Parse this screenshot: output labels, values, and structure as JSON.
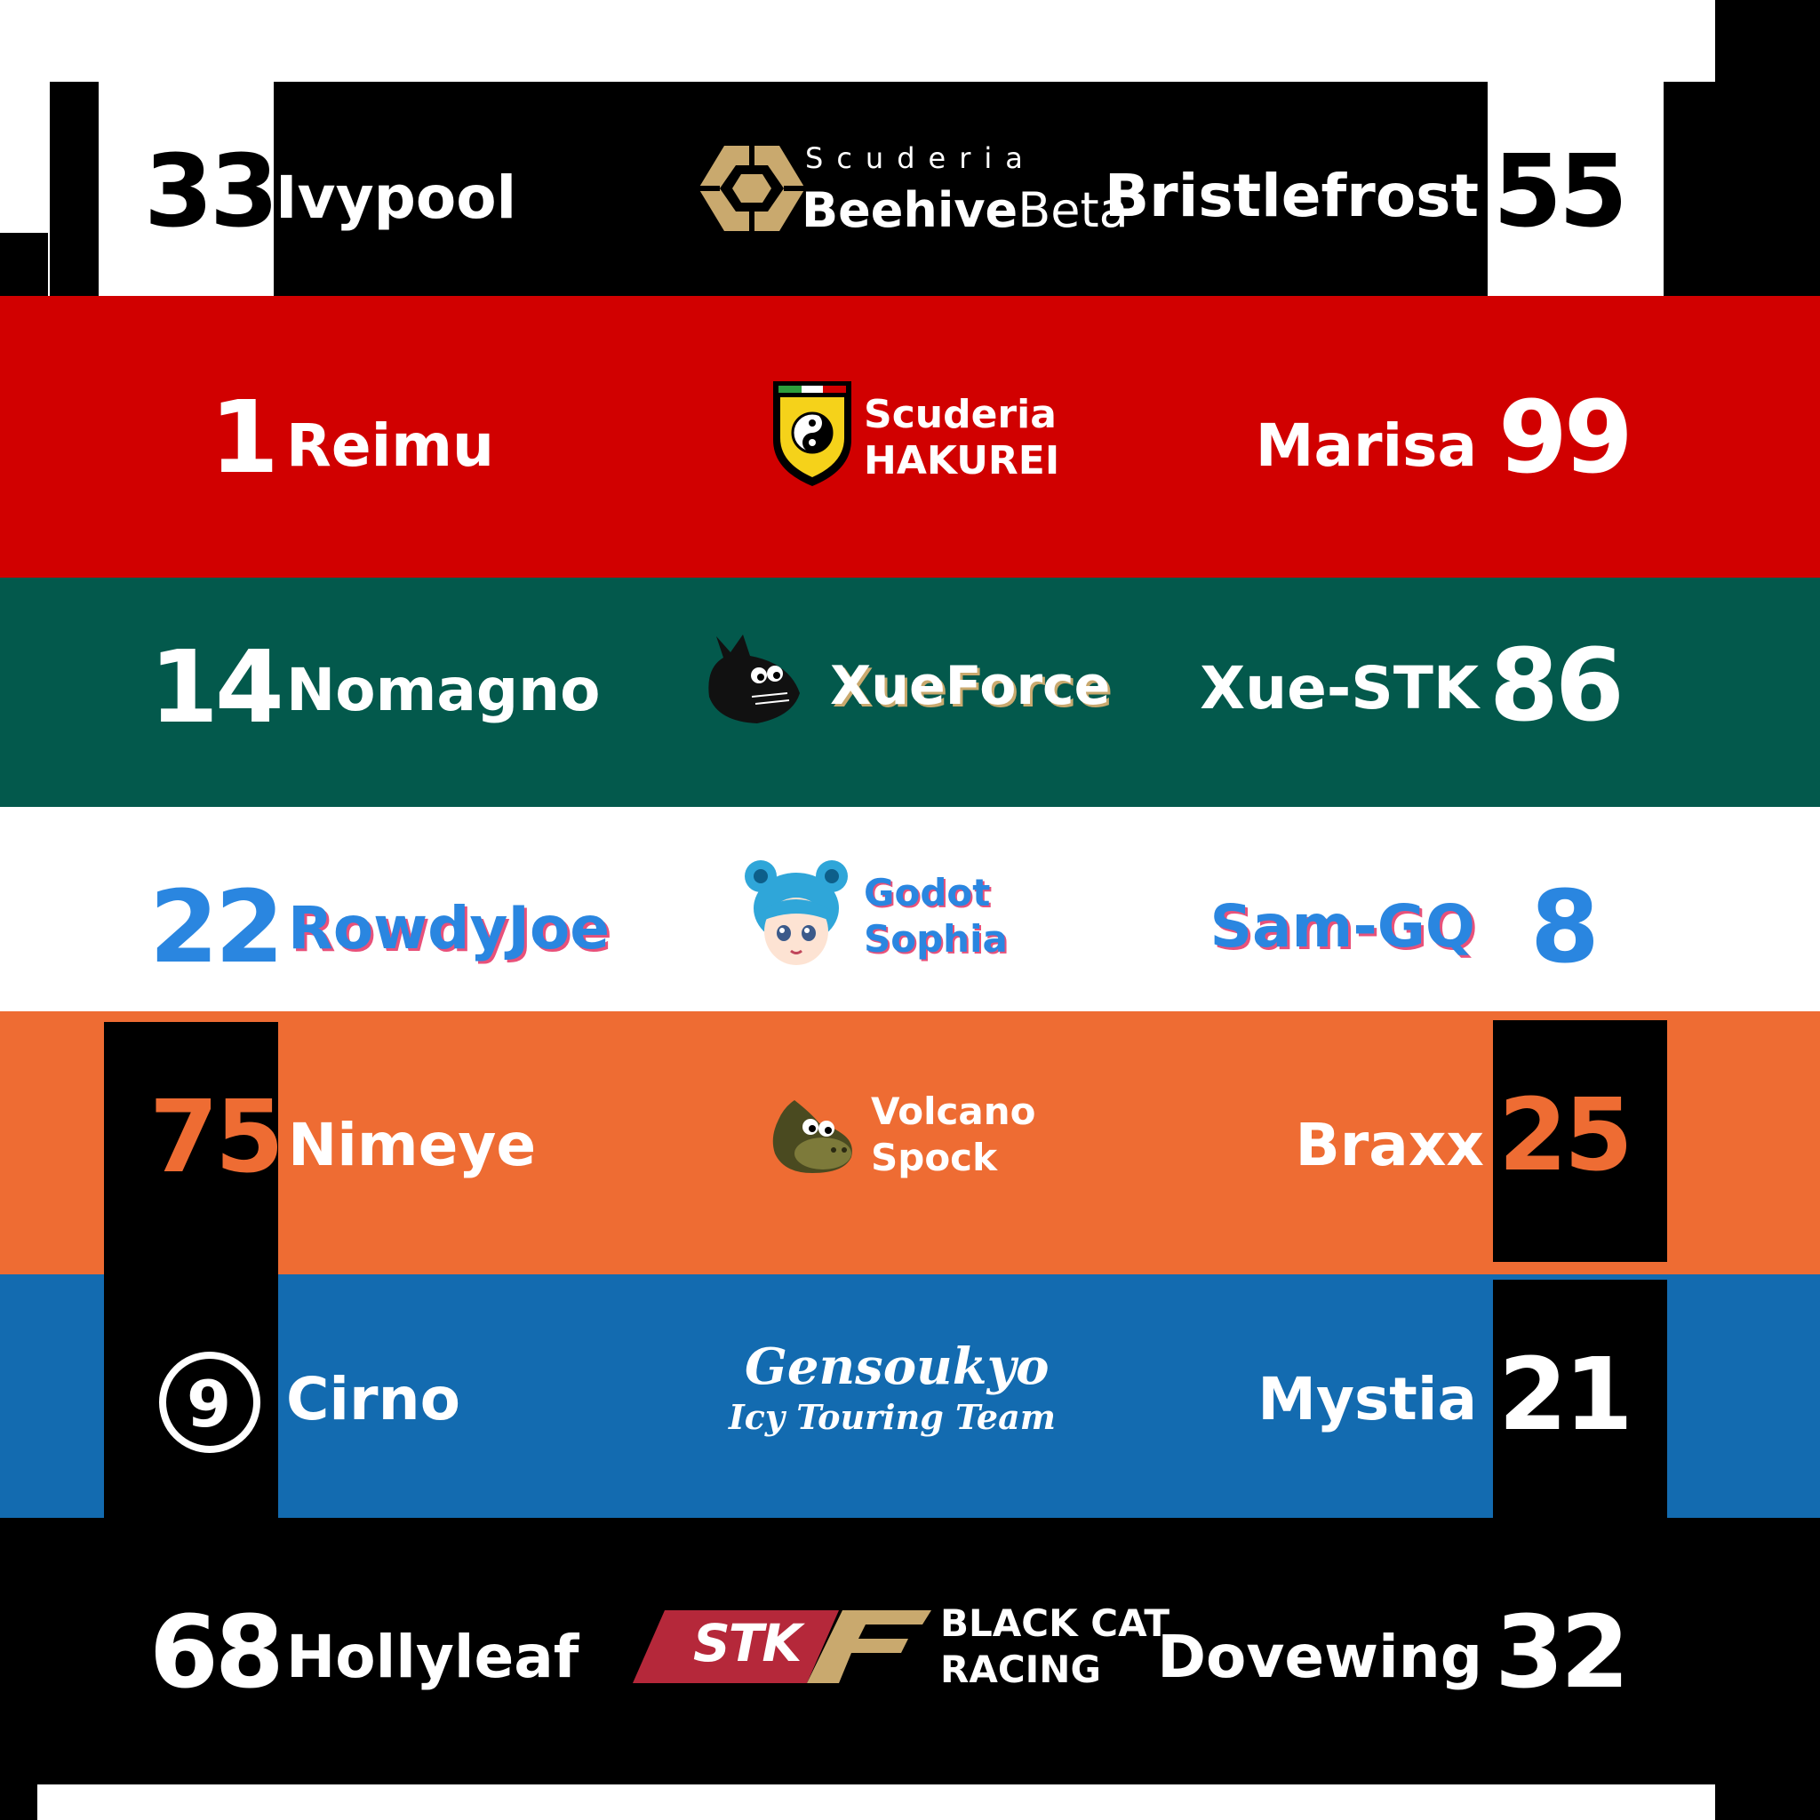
{
  "rows": [
    {
      "left_number": "33",
      "left_driver": "Ivypool",
      "team_line1": "Scuderia",
      "team_line2a": "Beehive",
      "team_line2b": "Beta",
      "right_driver": "Bristlefrost",
      "right_number": "55",
      "logo": "honeycomb-icon"
    },
    {
      "left_number": "1",
      "left_driver": "Reimu",
      "team_line1": "Scuderia",
      "team_line2": "HAKUREI",
      "right_driver": "Marisa",
      "right_number": "99",
      "logo": "yin-yang-shield-icon"
    },
    {
      "left_number": "14",
      "left_driver": "Nomagno",
      "team_name": "XueForce",
      "right_driver": "Xue-STK",
      "right_number": "86",
      "logo": "black-creature-icon"
    },
    {
      "left_number": "22",
      "left_driver": "RowdyJoe",
      "team_line1": "Godot",
      "team_line2": "Sophia",
      "right_driver": "Sam-GQ",
      "right_number": "8",
      "logo": "blue-hair-girl-icon"
    },
    {
      "left_number": "75",
      "left_driver": "Nimeye",
      "team_line1": "Volcano",
      "team_line2": "Spock",
      "right_driver": "Braxx",
      "right_number": "25",
      "logo": "olive-creature-icon"
    },
    {
      "left_number": "9",
      "left_driver": "Cirno",
      "team_line1": "Gensoukyo",
      "team_line2": "Icy Touring Team",
      "right_driver": "Mystia",
      "right_number": "21",
      "logo": "circled-number-icon"
    },
    {
      "left_number": "68",
      "left_driver": "Hollyleaf",
      "team_logo_text": "STK",
      "team_line1": "BLACK CAT",
      "team_line2": "RACING",
      "right_driver": "Dovewing",
      "right_number": "32",
      "logo": "stk-f-logo"
    }
  ],
  "colors": {
    "black": "#000000",
    "white": "#ffffff",
    "red": "#d10000",
    "green": "#03594c",
    "blue_text": "#2a86e0",
    "pink_shadow": "#e8517a",
    "orange": "#ee6c33",
    "blue": "#136bb0",
    "gold": "#c9a96e",
    "stk_red": "#b5283a"
  }
}
